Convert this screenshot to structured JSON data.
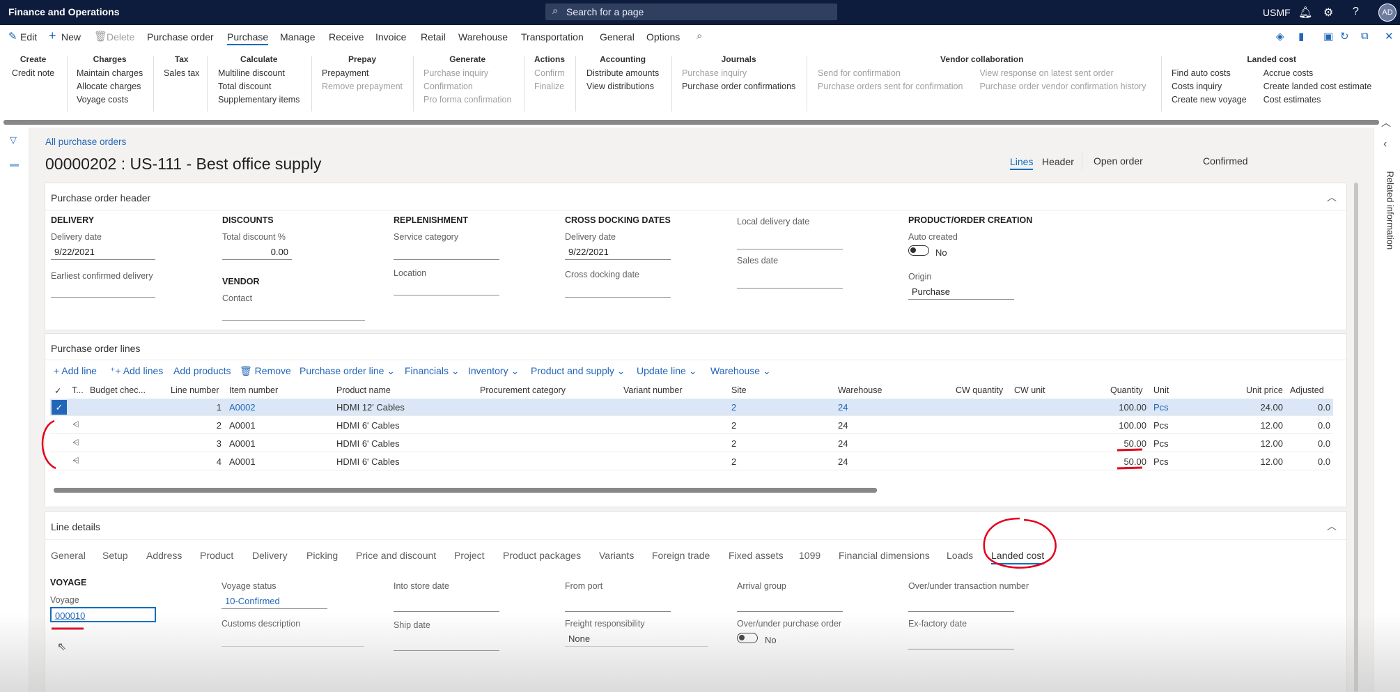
{
  "topbar": {
    "app_title": "Finance and Operations",
    "search_placeholder": "Search for a page",
    "company": "USMF",
    "avatar_initials": "AD",
    "icons": [
      "bell-icon",
      "gear-icon",
      "help-icon"
    ]
  },
  "actionbar": {
    "edit": "Edit",
    "new": "New",
    "delete": "Delete",
    "tabs": [
      "Purchase order",
      "Purchase",
      "Manage",
      "Receive",
      "Invoice",
      "Retail",
      "Warehouse",
      "Transportation",
      "General",
      "Options"
    ],
    "selected_tab": "Purchase"
  },
  "ribbon": {
    "create": {
      "header": "Create",
      "items": [
        "Credit note"
      ]
    },
    "charges": {
      "header": "Charges",
      "items": [
        "Maintain charges",
        "Allocate charges",
        "Voyage costs"
      ]
    },
    "tax": {
      "header": "Tax",
      "items": [
        "Sales tax"
      ]
    },
    "calculate": {
      "header": "Calculate",
      "items": [
        "Multiline discount",
        "Total discount",
        "Supplementary items"
      ]
    },
    "prepay": {
      "header": "Prepay",
      "items": [
        "Prepayment",
        "Remove prepayment"
      ]
    },
    "generate": {
      "header": "Generate",
      "items": [
        "Purchase inquiry",
        "Confirmation",
        "Pro forma confirmation"
      ]
    },
    "actions": {
      "header": "Actions",
      "items": [
        "Confirm",
        "Finalize"
      ]
    },
    "accounting": {
      "header": "Accounting",
      "items": [
        "Distribute amounts",
        "View distributions"
      ]
    },
    "journals": {
      "header": "Journals",
      "items": [
        "Purchase inquiry",
        "Purchase order confirmations"
      ]
    },
    "vendor_collab": {
      "header": "Vendor collaboration",
      "col1": [
        "Send for confirmation",
        "Purchase orders sent for confirmation"
      ],
      "col2": [
        "View response on latest sent order",
        "Purchase order vendor confirmation history"
      ]
    },
    "landed_cost": {
      "header": "Landed cost",
      "col1": [
        "Find auto costs",
        "Costs inquiry",
        "Create new voyage"
      ],
      "col2": [
        "Accrue costs",
        "Create landed cost estimate",
        "Cost estimates"
      ]
    }
  },
  "page": {
    "breadcrumb": "All purchase orders",
    "title": "00000202 : US-111 - Best office supply",
    "view_tabs": [
      "Lines",
      "Header"
    ],
    "order_status": "Open order",
    "doc_status": "Confirmed",
    "related_info": "Related information"
  },
  "po_header": {
    "title": "Purchase order header",
    "delivery": {
      "head": "DELIVERY",
      "delivery_date_label": "Delivery date",
      "delivery_date": "9/22/2021",
      "earliest_label": "Earliest confirmed delivery",
      "earliest": ""
    },
    "discounts": {
      "head": "DISCOUNTS",
      "total_discount_label": "Total discount %",
      "total_discount": "0.00"
    },
    "vendor": {
      "head": "VENDOR",
      "contact_label": "Contact",
      "contact": ""
    },
    "replenishment": {
      "head": "REPLENISHMENT",
      "service_category_label": "Service category",
      "location_label": "Location"
    },
    "cross_docking": {
      "head": "CROSS DOCKING DATES",
      "delivery_date_label": "Delivery date",
      "delivery_date": "9/22/2021",
      "cross_docking_date_label": "Cross docking date"
    },
    "local": {
      "local_delivery_label": "Local delivery date",
      "sales_date_label": "Sales date"
    },
    "product_order": {
      "head": "PRODUCT/ORDER CREATION",
      "auto_created_label": "Auto created",
      "auto_created": "No",
      "origin_label": "Origin",
      "origin": "Purchase"
    }
  },
  "po_lines": {
    "title": "Purchase order lines",
    "toolbar": [
      "Add line",
      "Add lines",
      "Add products",
      "Remove",
      "Purchase order line",
      "Financials",
      "Inventory",
      "Product and supply",
      "Update line",
      "Warehouse"
    ],
    "columns": {
      "type": "T...",
      "budget": "Budget chec...",
      "line": "Line number",
      "item": "Item number",
      "product": "Product name",
      "category": "Procurement category",
      "variant": "Variant number",
      "site": "Site",
      "warehouse": "Warehouse",
      "cwqty": "CW quantity",
      "cwunit": "CW unit",
      "quantity": "Quantity",
      "unit": "Unit",
      "unit_price": "Unit price",
      "adjusted": "Adjusted"
    },
    "rows": [
      {
        "line": "1",
        "item": "A0002",
        "product": "HDMI 12' Cables",
        "site": "2",
        "warehouse": "24",
        "quantity": "100.00",
        "unit": "Pcs",
        "unit_price": "24.00",
        "adjusted": "0.0"
      },
      {
        "line": "2",
        "item": "A0001",
        "product": "HDMI 6' Cables",
        "site": "2",
        "warehouse": "24",
        "quantity": "100.00",
        "unit": "Pcs",
        "unit_price": "12.00",
        "adjusted": "0.0"
      },
      {
        "line": "3",
        "item": "A0001",
        "product": "HDMI 6' Cables",
        "site": "2",
        "warehouse": "24",
        "quantity": "50.00",
        "unit": "Pcs",
        "unit_price": "12.00",
        "adjusted": "0.0"
      },
      {
        "line": "4",
        "item": "A0001",
        "product": "HDMI 6' Cables",
        "site": "2",
        "warehouse": "24",
        "quantity": "50.00",
        "unit": "Pcs",
        "unit_price": "12.00",
        "adjusted": "0.0"
      }
    ]
  },
  "line_details": {
    "title": "Line details",
    "tabs": [
      "General",
      "Setup",
      "Address",
      "Product",
      "Delivery",
      "Picking",
      "Price and discount",
      "Project",
      "Product packages",
      "Variants",
      "Foreign trade",
      "Fixed assets",
      "1099",
      "Financial dimensions",
      "Loads",
      "Landed cost"
    ],
    "selected_tab": "Landed cost",
    "voyage_head": "VOYAGE",
    "voyage_label": "Voyage",
    "voyage": "000010",
    "voyage_status_label": "Voyage status",
    "voyage_status": "10-Confirmed",
    "customs_label": "Customs description",
    "into_store_label": "Into store date",
    "ship_date_label": "Ship date",
    "from_port_label": "From port",
    "freight_label": "Freight responsibility",
    "freight": "None",
    "arrival_group_label": "Arrival group",
    "over_under_po_label": "Over/under purchase order",
    "over_under_po": "No",
    "over_under_txn_label": "Over/under transaction number",
    "ex_factory_label": "Ex-factory date"
  },
  "colors": {
    "topbar": "#0d1c3d",
    "accent": "#0f6cbd",
    "link": "#2266b8",
    "annotation": "#e3001b"
  }
}
